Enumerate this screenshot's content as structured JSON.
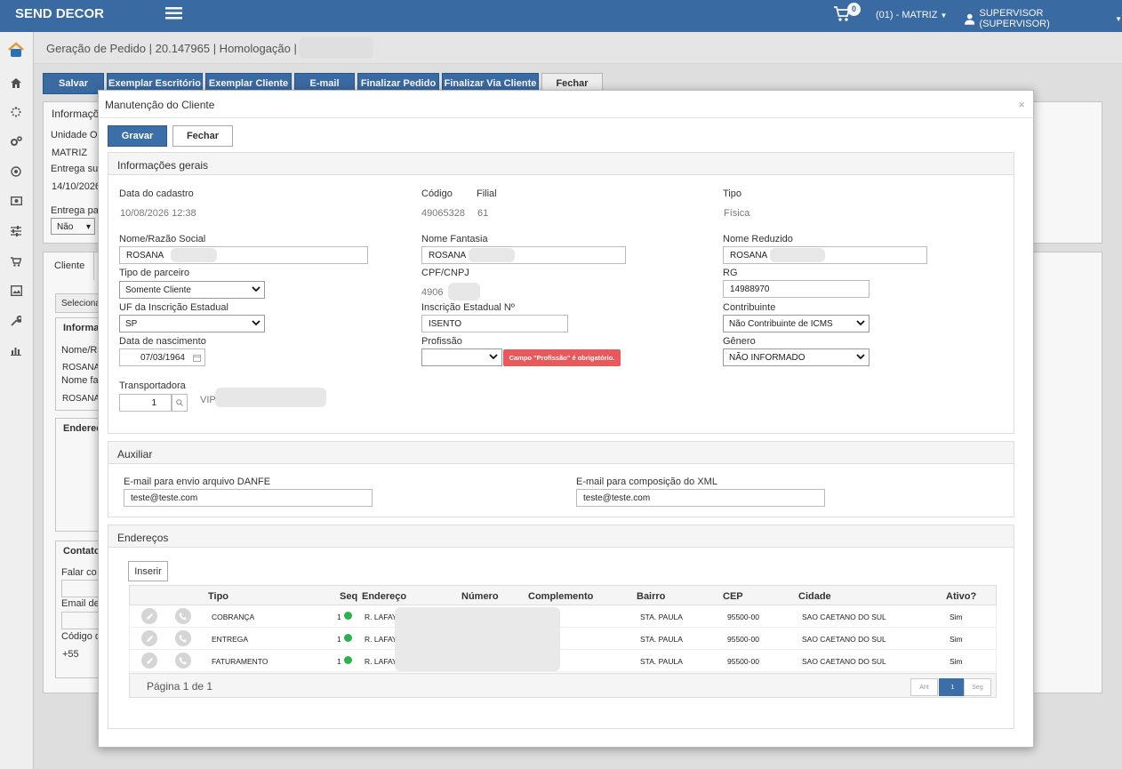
{
  "app": {
    "brand": "SEND DECOR",
    "cart_count": "0",
    "branch": "(01) - MATRIZ",
    "user": "SUPERVISOR (SUPERVISOR)"
  },
  "colors": {
    "primary": "#3c6ea8",
    "error": "#e9595b",
    "active": "#2bb24c"
  },
  "sidebar": {
    "icons": [
      "logo-icon",
      "home-icon",
      "spinner-icon",
      "gears-icon",
      "target-icon",
      "money-icon",
      "sliders-icon",
      "cart-icon",
      "picture-icon",
      "wrench-icon",
      "bar-chart-icon"
    ]
  },
  "page": {
    "breadcrumb": "Geração de Pedido | 20.147965 | Homologação | S",
    "toolbar": {
      "save": "Salvar",
      "office_copy": "Exemplar Escritório",
      "client_copy": "Exemplar Cliente",
      "email": "E-mail",
      "finish_order": "Finalizar Pedido",
      "finish_client": "Finalizar Via Cliente",
      "close": "Fechar"
    },
    "bg": {
      "info_header": "Informações",
      "unit_label": "Unidade Op",
      "unit_value": "MATRIZ",
      "delivery_label": "Entrega sup",
      "delivery_date": "14/10/2026",
      "delivery_for_label": "Entrega pa",
      "delivery_for_value": "Não",
      "client_tab": "Cliente",
      "select_btn": "Seleciona",
      "info2": "Informaç",
      "name_label": "Nome/Ra",
      "name_value": "ROSANA",
      "fantasy_label": "Nome fa",
      "fantasy_value": "ROSANA",
      "address_header": "Endereç",
      "contacts_header": "Contato",
      "talk_label": "Falar co",
      "email_label": "Email de",
      "code_label": "Código d",
      "phone_prefix": "+55"
    }
  },
  "modal": {
    "title": "Manutenção do Cliente",
    "close_x": "×",
    "save": "Gravar",
    "close": "Fechar",
    "general": {
      "header": "Informações gerais",
      "reg_date_label": "Data do cadastro",
      "reg_date": "10/08/2026 12:38",
      "code_label": "Código",
      "code": "49065328",
      "branch_label": "Filial",
      "branch": "61",
      "type_label": "Tipo",
      "type": "Física",
      "name_label": "Nome/Razão Social",
      "name_value": "ROSANA",
      "fantasy_label": "Nome Fantasia",
      "fantasy_value": "ROSANA",
      "short_label": "Nome Reduzido",
      "short_value": "ROSANA",
      "partner_label": "Tipo de parceiro",
      "partner_value": "Somente Cliente",
      "cpf_label": "CPF/CNPJ",
      "cpf_value": "4906",
      "rg_label": "RG",
      "rg_value": "14988970",
      "uf_label": "UF da Inscrição Estadual",
      "uf_value": "SP",
      "ie_label": "Inscrição Estadual Nº",
      "ie_value": "ISENTO",
      "contrib_label": "Contribuinte",
      "contrib_value": "Não Contribuinte de ICMS",
      "birth_label": "Data de nascimento",
      "birth_value": "07/03/1964",
      "prof_label": "Profissão",
      "prof_value": "",
      "prof_error": "Campo \"Profissão\" é obrigatório.",
      "gender_label": "Gênero",
      "gender_value": "NÃO INFORMADO",
      "carrier_label": "Transportadora",
      "carrier_value": "1",
      "carrier_name": "VIP"
    },
    "aux": {
      "header": "Auxiliar",
      "danfe_label": "E-mail para envio arquivo DANFE",
      "danfe_value": "teste@teste.com",
      "xml_label": "E-mail para composição do XML",
      "xml_value": "teste@teste.com"
    },
    "addresses": {
      "header": "Endereços",
      "insert": "Inserir",
      "columns": [
        "Tipo",
        "Seq",
        "Endereço",
        "Número",
        "Complemento",
        "Bairro",
        "CEP",
        "Cidade",
        "Ativo?"
      ],
      "rows": [
        {
          "tipo": "COBRANÇA",
          "seq": "1",
          "endereco": "R. LAFAY",
          "bairro": "STA. PAULA",
          "cep": "95500-00",
          "cidade": "SAO CAETANO DO SUL",
          "ativo": "Sim"
        },
        {
          "tipo": "ENTREGA",
          "seq": "1",
          "endereco": "R. LAFAY",
          "bairro": "STA. PAULA",
          "cep": "95500-00",
          "cidade": "SAO CAETANO DO SUL",
          "ativo": "Sim"
        },
        {
          "tipo": "FATURAMENTO",
          "seq": "1",
          "endereco": "R. LAFAY",
          "bairro": "STA. PAULA",
          "cep": "95500-00",
          "cidade": "SAO CAETANO DO SUL",
          "ativo": "Sim"
        }
      ],
      "pagination": "Página 1 de 1",
      "prev": "Ant",
      "page": "1",
      "next": "Seg"
    }
  }
}
